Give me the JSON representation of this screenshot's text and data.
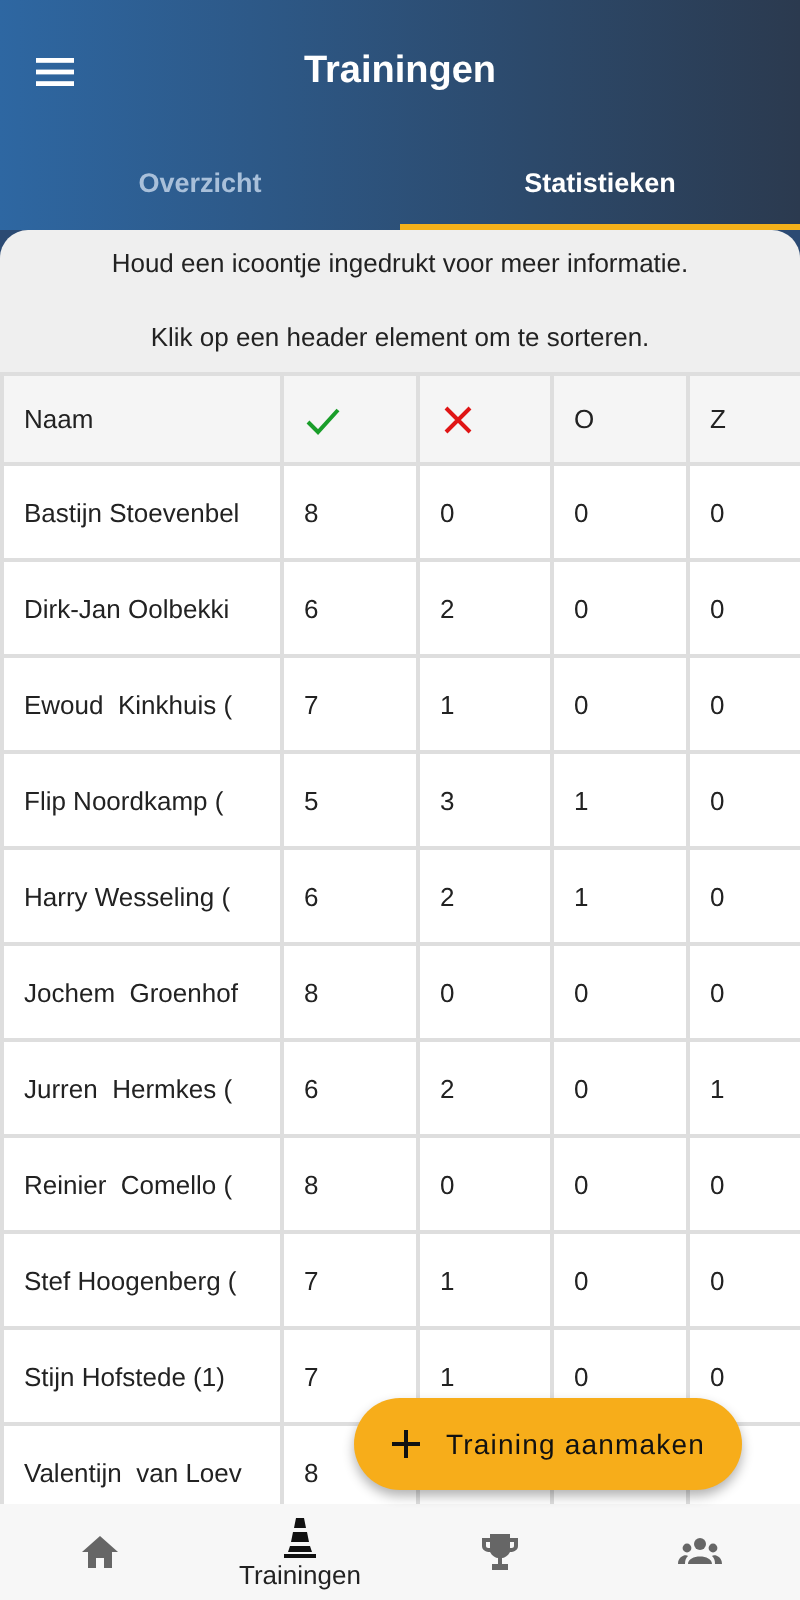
{
  "app_bar": {
    "title": "Trainingen"
  },
  "tabs": [
    {
      "label": "Overzicht",
      "selected": false
    },
    {
      "label": "Statistieken",
      "selected": true
    }
  ],
  "info": [
    "Houd een icoontje ingedrukt voor meer informatie.",
    "Klik op een header element om te sorteren."
  ],
  "table": {
    "columns": [
      {
        "kind": "text",
        "label": "Naam"
      },
      {
        "kind": "check"
      },
      {
        "kind": "cross"
      },
      {
        "kind": "text",
        "label": "O"
      },
      {
        "kind": "text",
        "label": "Z"
      }
    ],
    "rows": [
      [
        "Bastijn Stoevenbel",
        "8",
        "0",
        "0",
        "0"
      ],
      [
        "Dirk-Jan Oolbekki",
        "6",
        "2",
        "0",
        "0"
      ],
      [
        "Ewoud  Kinkhuis (",
        "7",
        "1",
        "0",
        "0"
      ],
      [
        "Flip Noordkamp (",
        "5",
        "3",
        "1",
        "0"
      ],
      [
        "Harry Wesseling (",
        "6",
        "2",
        "1",
        "0"
      ],
      [
        "Jochem  Groenhof",
        "8",
        "0",
        "0",
        "0"
      ],
      [
        "Jurren  Hermkes (",
        "6",
        "2",
        "0",
        "1"
      ],
      [
        "Reinier  Comello (",
        "8",
        "0",
        "0",
        "0"
      ],
      [
        "Stef Hoogenberg (",
        "7",
        "1",
        "0",
        "0"
      ],
      [
        "Stijn Hofstede (1)",
        "7",
        "1",
        "0",
        "0"
      ],
      [
        "Valentijn  van Loev",
        "8"
      ]
    ]
  },
  "fab": {
    "label": "Training aanmaken"
  },
  "bottom_nav": [
    {
      "kind": "home",
      "selected": false
    },
    {
      "kind": "cone",
      "label": "Trainingen",
      "selected": true
    },
    {
      "kind": "trophy",
      "selected": false
    },
    {
      "kind": "group",
      "selected": false
    }
  ]
}
